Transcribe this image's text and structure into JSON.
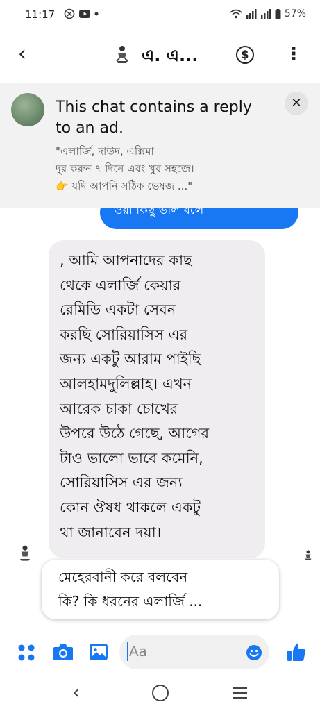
{
  "status_bar": {
    "time": "11:17",
    "battery": "57%"
  },
  "header": {
    "title": "এ. এ..."
  },
  "ad_banner": {
    "title": "This chat contains a reply to an ad.",
    "snippet_line1": "\"এলার্জি, দাউদ, এক্সিমা",
    "snippet_line2": "দুর করুন ৭ দিনে এবং খুব সহজে।",
    "snippet_line3": "👉 যদি আপনি সঠিক ভেষজ ...\""
  },
  "messages": {
    "outgoing_partial": "ওরা কিছু ভাল বলে",
    "incoming_lines": [
      ", আমি আপনাদের কাছ",
      "থেকে এলার্জি কেয়ার",
      "রেমিডি একটা সেবন",
      "করছি সোরিয়াসিস এর",
      "জন্য একটু আরাম পাইছি",
      "আলহামদুলিল্লাহ। এখন",
      "আরেক চাকা চোখের",
      "উপরে উঠে গেছে,  আগের",
      "টাও ভালো ভাবে কমেনি,",
      "সোরিয়াসিস এর জন্য",
      "কোন ঔষধ থাকলে একটু",
      "থা জানাবেন দয়া।"
    ],
    "reply_line1": "মেহেরবানী করে বলবেন",
    "reply_line2": "কি? কি ধরনের এলার্জি ..."
  },
  "composer": {
    "placeholder": "Aa"
  },
  "colors": {
    "accent": "#1877f2",
    "incoming_bubble": "#efedf0",
    "banner_bg": "#f2f2f2"
  }
}
